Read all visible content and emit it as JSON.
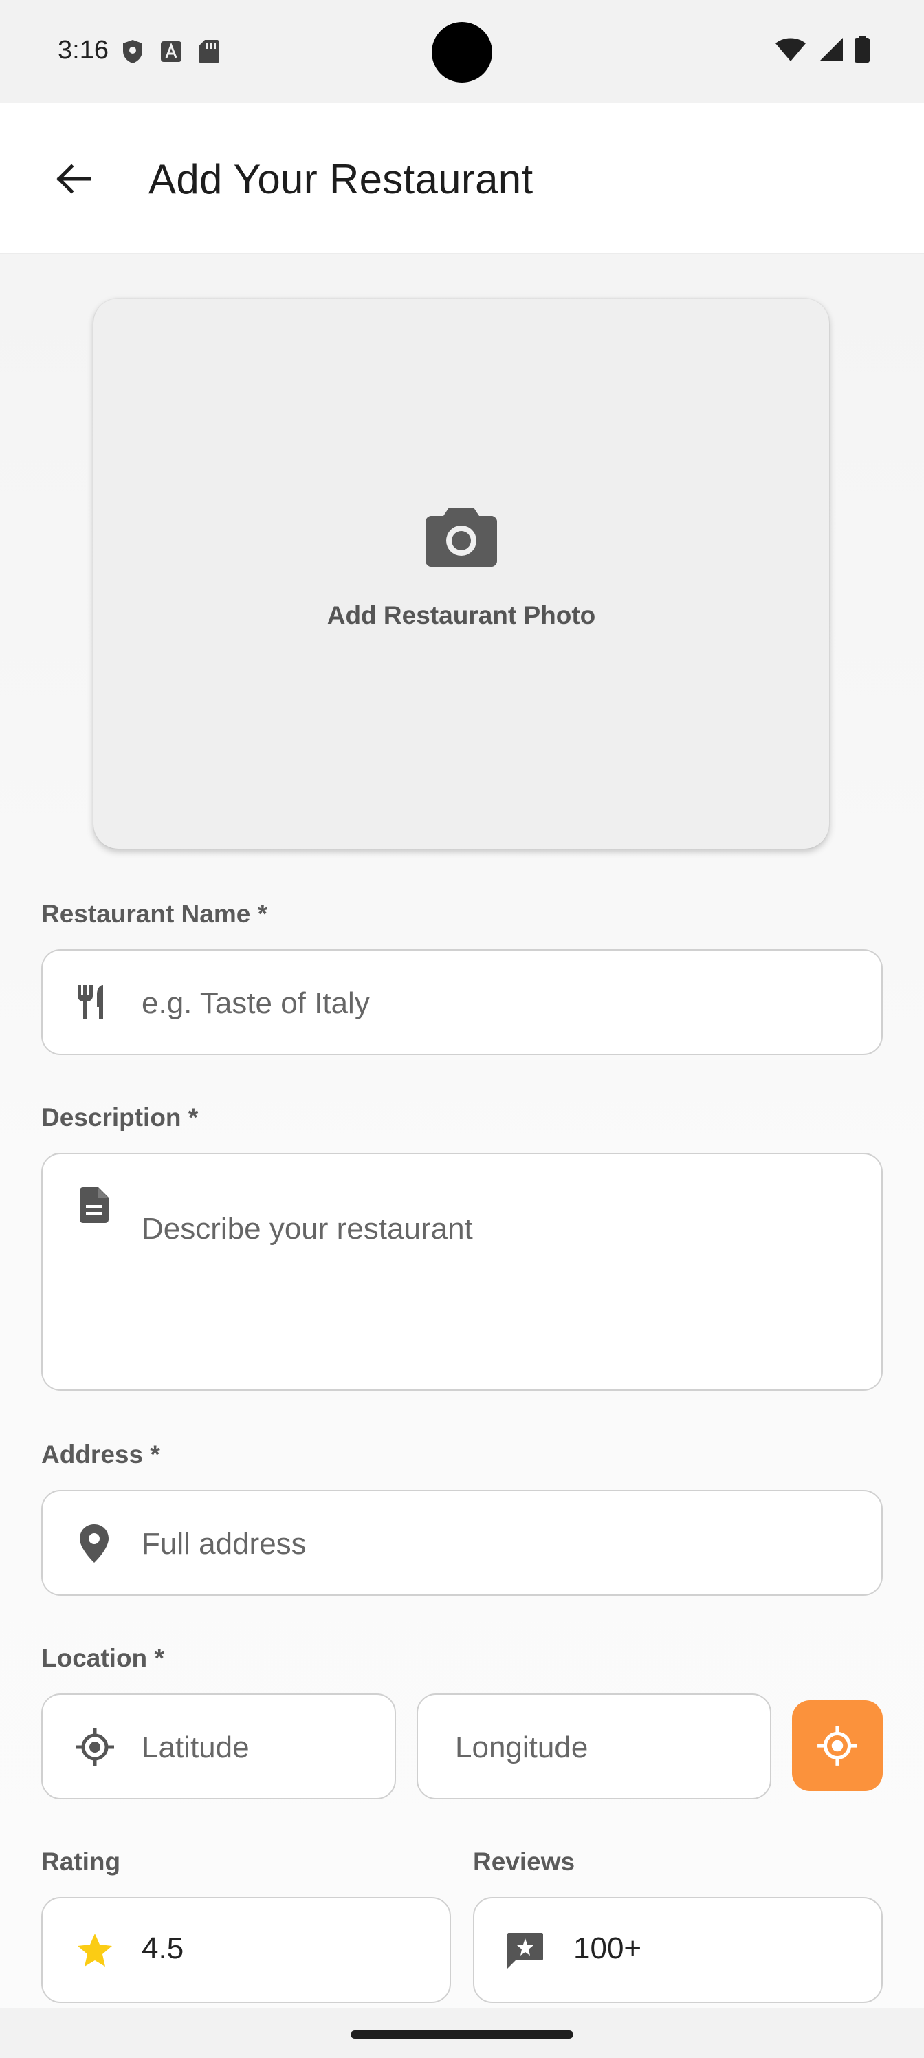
{
  "status_bar": {
    "time": "3:16",
    "left_icons": [
      "shield-icon",
      "font-download-icon",
      "sd-card-icon"
    ],
    "right_icons": [
      "wifi-icon",
      "cell-signal-icon",
      "battery-icon"
    ]
  },
  "app_bar": {
    "title": "Add Your Restaurant",
    "back_icon": "arrow-back-icon"
  },
  "photo": {
    "label": "Add Restaurant Photo",
    "icon": "camera-icon"
  },
  "form": {
    "name": {
      "label": "Restaurant Name *",
      "placeholder": "e.g. Taste of Italy",
      "icon": "restaurant-icon"
    },
    "description": {
      "label": "Description *",
      "placeholder": "Describe your restaurant",
      "icon": "description-icon"
    },
    "address": {
      "label": "Address *",
      "placeholder": "Full address",
      "icon": "location-pin-icon"
    },
    "location": {
      "label": "Location *",
      "latitude_placeholder": "Latitude",
      "longitude_placeholder": "Longitude",
      "latitude_icon": "gps-icon",
      "locate_button_icon": "my-location-icon"
    },
    "rating": {
      "label": "Rating",
      "value": "4.5",
      "icon": "star-icon"
    },
    "reviews": {
      "label": "Reviews",
      "value": "100+",
      "icon": "review-icon"
    }
  },
  "colors": {
    "accent": "#fb923c",
    "star": "#fbcc14",
    "icon_gray": "#555555"
  }
}
